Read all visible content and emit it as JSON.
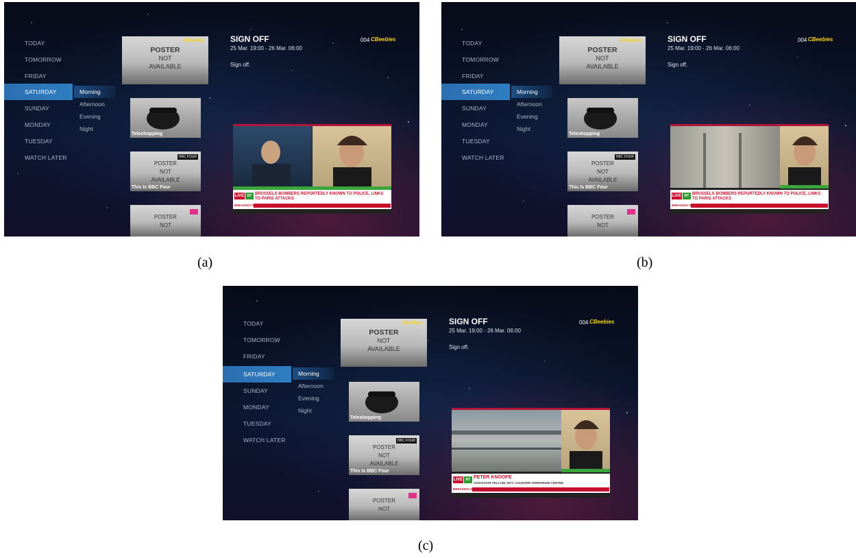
{
  "menu": [
    "TODAY",
    "TOMORROW",
    "FRIDAY",
    "SATURDAY",
    "SUNDAY",
    "MONDAY",
    "TUESDAY",
    "WATCH LATER"
  ],
  "active_day": "SATURDAY",
  "submenu": [
    "Morning",
    "Afternoon",
    "Evening",
    "Night"
  ],
  "active_period": "Morning",
  "poster": {
    "line1": "POSTER",
    "line2": "NOT",
    "line3": "AVAILABLE"
  },
  "programmes": {
    "teleshopping": "Teleshopping",
    "bbc_four": "This Is BBC Four"
  },
  "channel_logos": {
    "cbeebies": "CBeebies",
    "bbc_four": "BBC FOUR"
  },
  "details": {
    "title": "SIGN OFF",
    "time": "25 Mar. 19:00 - 26 Mar. 06:00",
    "description": "Sign off.",
    "channel_number": "004"
  },
  "news": {
    "live": "LIVE",
    "rt": "RT",
    "headline_a": "BRUSSELS BOMBERS REPORTEDLY KNOWN TO POLICE, LINKS TO PARIS ATTACKS",
    "headline_c": "PETER KNOOPE",
    "subline_c": "ASSOCIATE FELLOW, INT'L COUNTER-TERRORISM CENTRE",
    "breaking": "BREAKING NEWS"
  },
  "captions": [
    "(a)",
    "(b)",
    "(c)"
  ],
  "colors": {
    "active": "#2f7dc2",
    "live_red": "#c8102e",
    "rt_green": "#2f9b2f"
  }
}
